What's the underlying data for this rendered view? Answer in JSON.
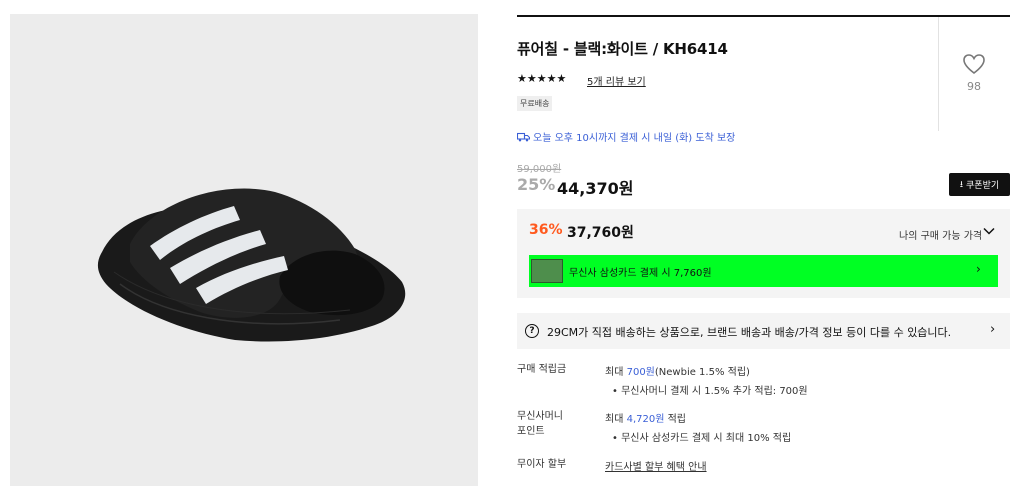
{
  "product": {
    "title": "퓨어칠 - 블랙:화이트 / KH6414",
    "stars": "★★★★★",
    "review_link": "5개 리뷰 보기",
    "badge": "무료배송",
    "like_count": "98",
    "delivery": "오늘 오후 10시까지 결제 시 내일 (화) 도착 보장"
  },
  "price": {
    "original": "59,000원",
    "discount": "25%",
    "sale": "44,370원",
    "coupon_button": "쿠폰받기"
  },
  "best_price": {
    "discount": "36%",
    "price": "37,760원",
    "label": "나의 구매 가능 가격"
  },
  "card_banner": {
    "text": "무신사 삼성카드 결제 시 7,760원"
  },
  "notice": {
    "text": "29CM가 직접 배송하는 상품으로, 브랜드 배송과 배송/가격 정보 등이 다를 수 있습니다."
  },
  "benefits": {
    "points_label": "구매 적립금",
    "points_prefix": "최대 ",
    "points_amount": "700원",
    "points_suffix": "(Newbie 1.5% 적립)",
    "points_sub": "•  무신사머니 결제 시 1.5% 추가 적립: 700원",
    "money_label_1": "무신사머니",
    "money_label_2": "포인트",
    "money_prefix": "최대 ",
    "money_amount": "4,720원",
    "money_suffix": " 적립",
    "money_sub": "•  무신사 삼성카드 결제 시 최대 10% 적립",
    "installment_label": "무이자 할부",
    "installment_link": "카드사별 할부 혜택 안내"
  }
}
